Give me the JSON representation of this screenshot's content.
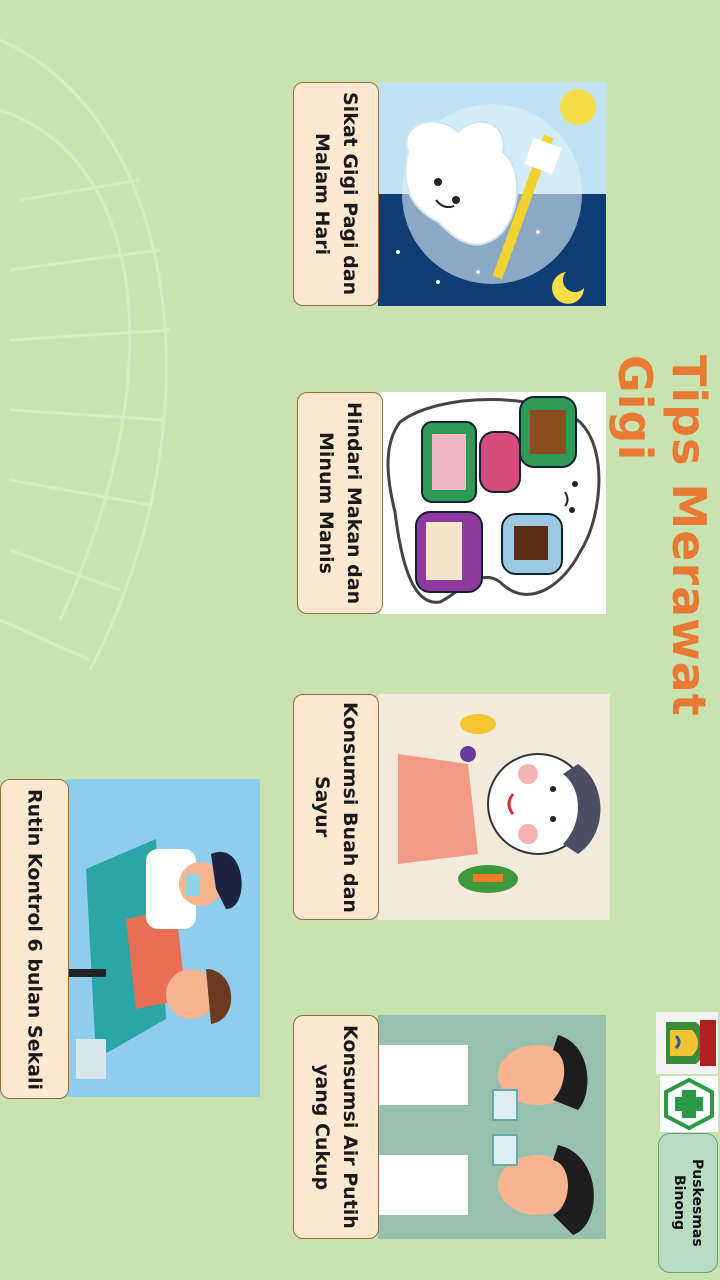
{
  "title": "Tips Merawat Gigi",
  "tips": [
    {
      "label": "Sikat Gigi  Pagi dan Malam Hari"
    },
    {
      "label": "Hindari Makan dan Minum Manis"
    },
    {
      "label": "Konsumsi Buah dan Sayur"
    },
    {
      "label": "Konsumsi Air Putih yang Cukup"
    },
    {
      "label": "Rutin Kontrol 6 bulan Sekali"
    }
  ],
  "badge": {
    "label": "Puskesmas Binong"
  },
  "colors": {
    "background": "#c8e2b0",
    "title": "#e87a33",
    "card": "#fde9d2",
    "badge": "#b9dcc4"
  }
}
